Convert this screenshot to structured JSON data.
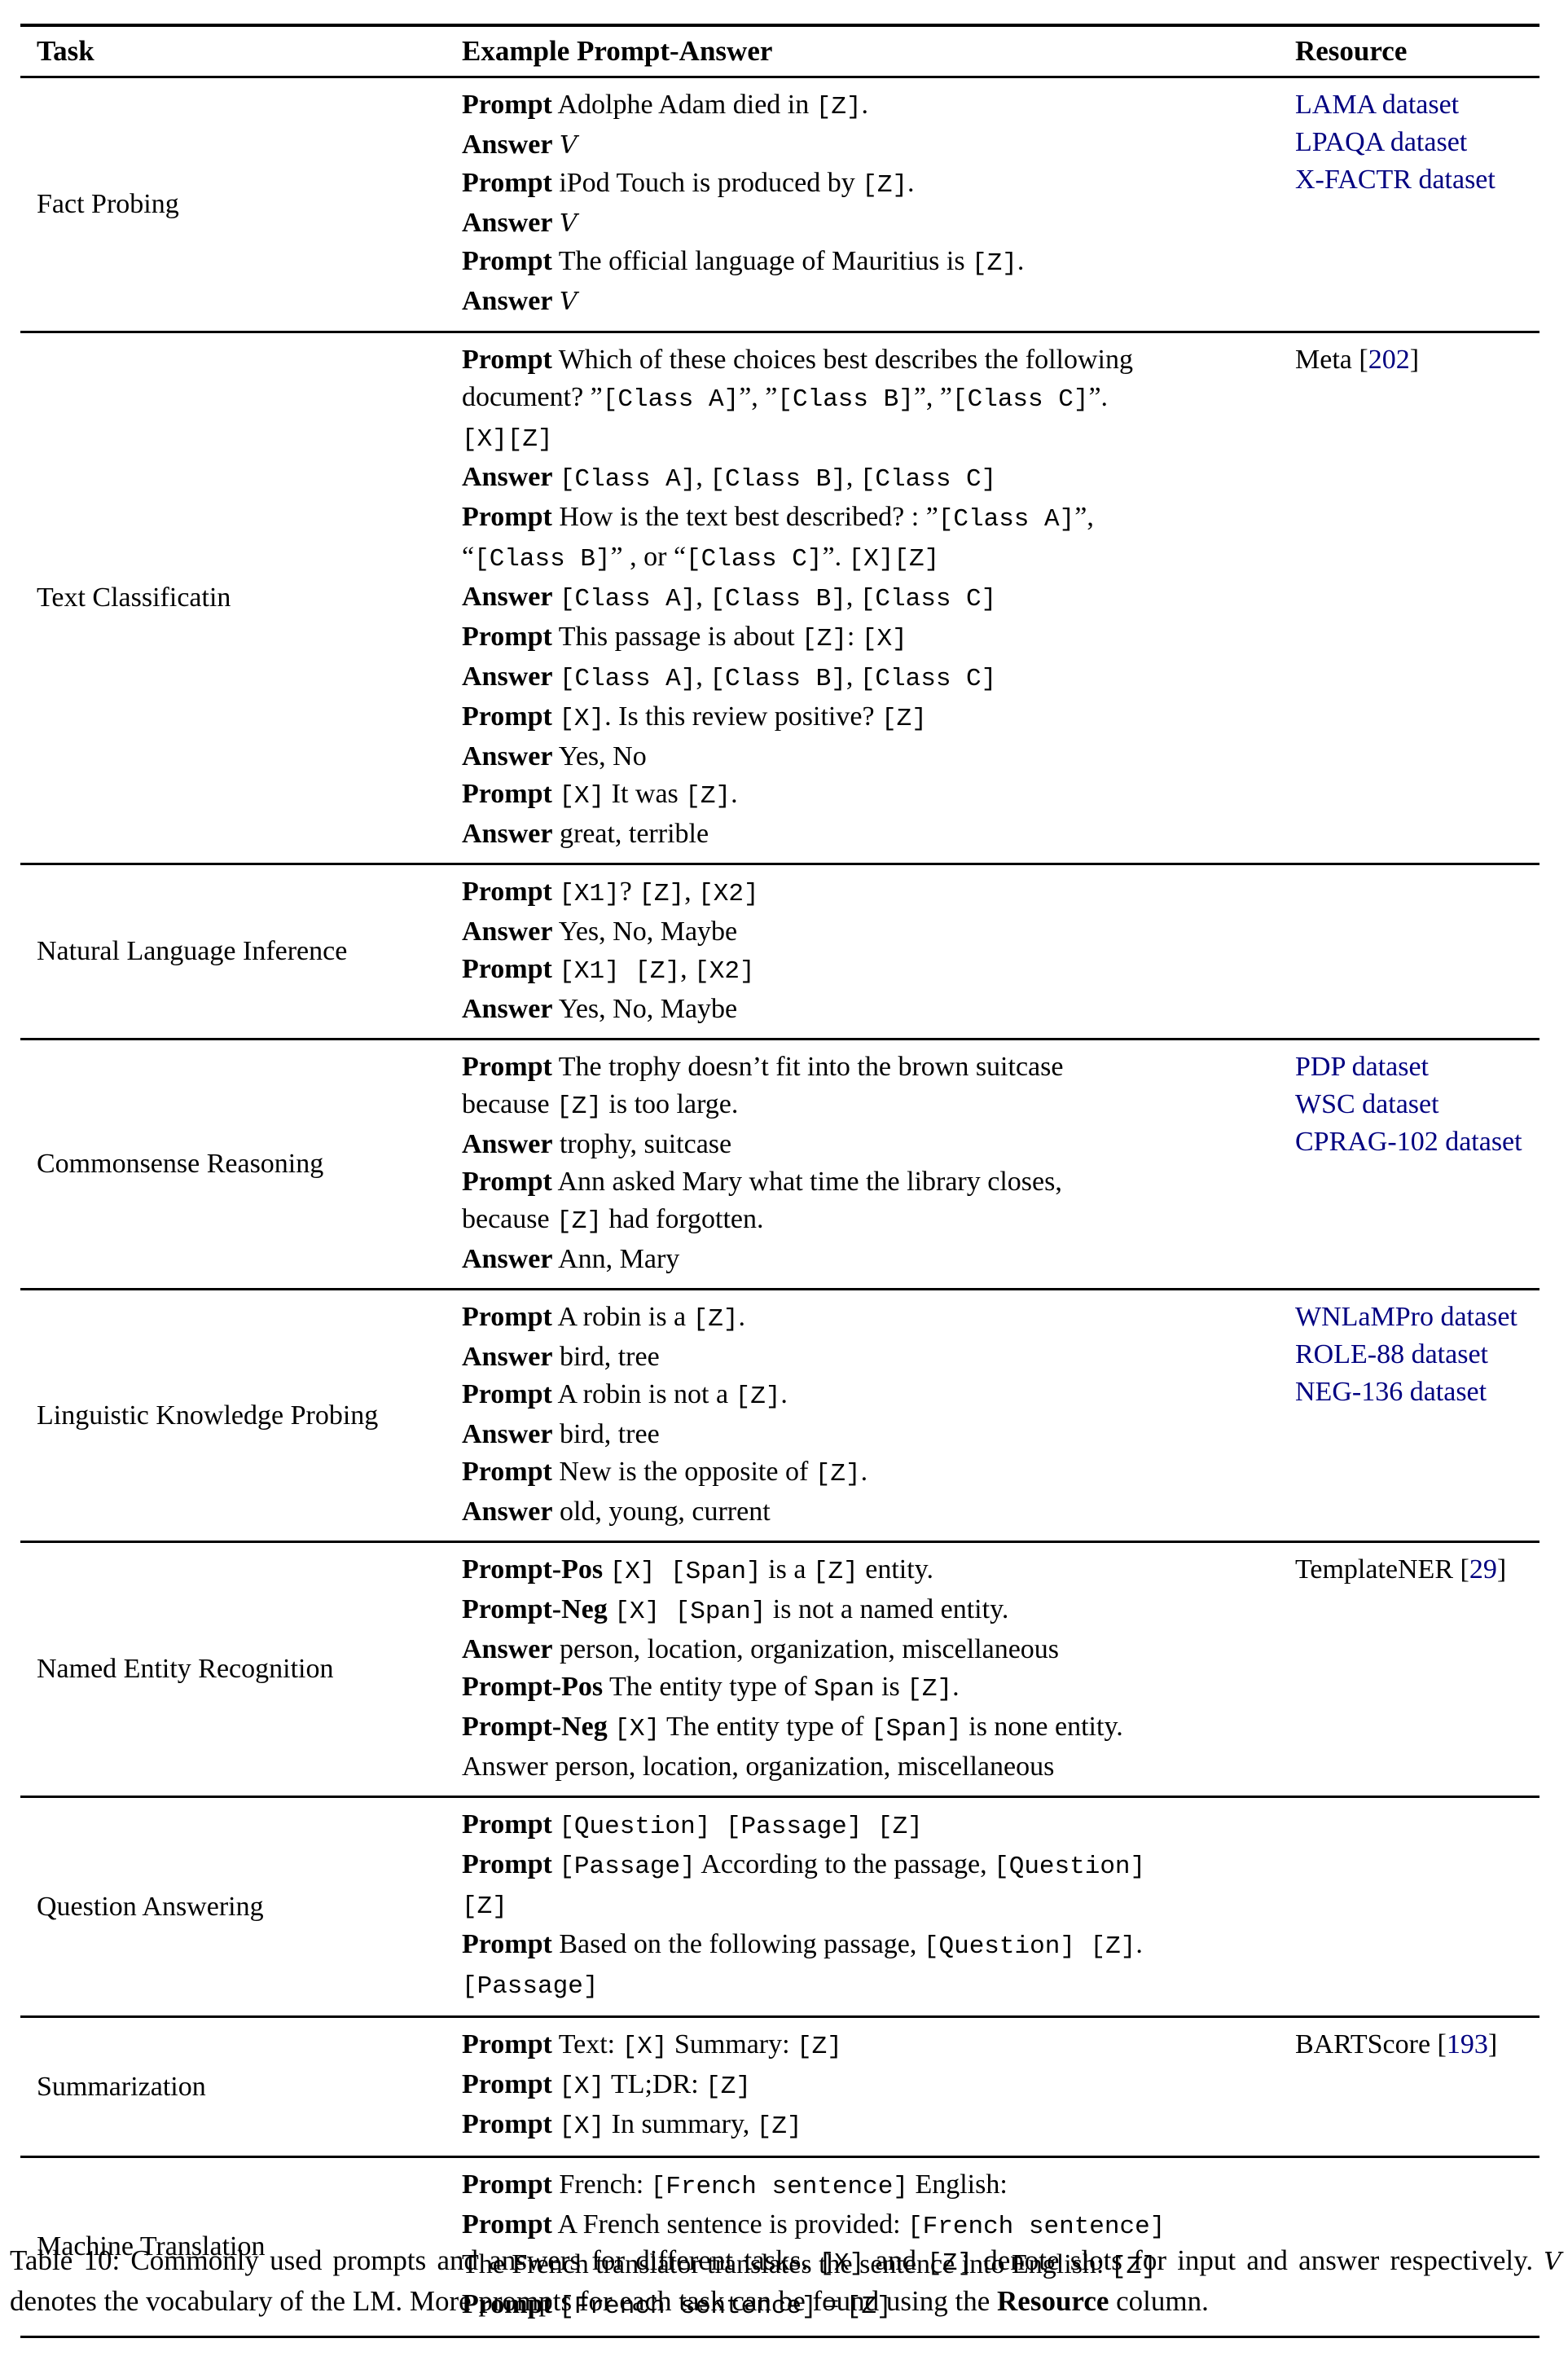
{
  "table": {
    "headers": [
      "Task",
      "Example Prompt-Answer",
      "Resource"
    ],
    "rows": [
      {
        "task": "Fact Probing",
        "lines": [
          {
            "label": "Prompt",
            "segs": [
              {
                "t": "Adolphe Adam died in "
              },
              {
                "m": "[Z]"
              },
              {
                "t": "."
              }
            ]
          },
          {
            "label": "Answer",
            "segs": [
              {
                "v": "V"
              }
            ]
          },
          {
            "label": "Prompt",
            "segs": [
              {
                "t": "iPod Touch is produced by "
              },
              {
                "m": "[Z]"
              },
              {
                "t": "."
              }
            ]
          },
          {
            "label": "Answer",
            "segs": [
              {
                "v": "V"
              }
            ]
          },
          {
            "label": "Prompt",
            "segs": [
              {
                "t": "The official language of Mauritius is "
              },
              {
                "m": "[Z]"
              },
              {
                "t": "."
              }
            ]
          },
          {
            "label": "Answer",
            "segs": [
              {
                "v": "V"
              }
            ]
          }
        ],
        "resources": [
          {
            "segs": [
              {
                "link": "LAMA dataset"
              }
            ]
          },
          {
            "segs": [
              {
                "link": "LPAQA dataset"
              }
            ]
          },
          {
            "segs": [
              {
                "link": "X-FACTR dataset"
              }
            ]
          }
        ]
      },
      {
        "task": "Text Classificatin",
        "lines": [
          {
            "label": "Prompt",
            "segs": [
              {
                "t": "Which of these choices best describes the following"
              }
            ]
          },
          {
            "label": "",
            "segs": [
              {
                "t": "document? ”"
              },
              {
                "m": "[Class A]"
              },
              {
                "t": "”, ”"
              },
              {
                "m": "[Class B]"
              },
              {
                "t": "”, ”"
              },
              {
                "m": "[Class C]"
              },
              {
                "t": "”."
              }
            ]
          },
          {
            "label": "",
            "segs": [
              {
                "m": "[X][Z]"
              }
            ]
          },
          {
            "label": "Answer",
            "segs": [
              {
                "m": "[Class A]"
              },
              {
                "t": ", "
              },
              {
                "m": "[Class B]"
              },
              {
                "t": ", "
              },
              {
                "m": "[Class C]"
              }
            ]
          },
          {
            "label": "Prompt",
            "segs": [
              {
                "t": "How is the text best described? : ”"
              },
              {
                "m": "[Class A]"
              },
              {
                "t": "”,"
              }
            ]
          },
          {
            "label": "",
            "segs": [
              {
                "t": "“"
              },
              {
                "m": "[Class B]"
              },
              {
                "t": "” , or “"
              },
              {
                "m": "[Class C]"
              },
              {
                "t": "”. "
              },
              {
                "m": "[X][Z]"
              }
            ]
          },
          {
            "label": "Answer",
            "segs": [
              {
                "m": "[Class A]"
              },
              {
                "t": ", "
              },
              {
                "m": "[Class B]"
              },
              {
                "t": ", "
              },
              {
                "m": "[Class C]"
              }
            ]
          },
          {
            "label": "Prompt",
            "segs": [
              {
                "t": "This passage is about "
              },
              {
                "m": "[Z]"
              },
              {
                "t": ": "
              },
              {
                "m": "[X]"
              }
            ]
          },
          {
            "label": "Answer",
            "segs": [
              {
                "m": "[Class A]"
              },
              {
                "t": ", "
              },
              {
                "m": "[Class B]"
              },
              {
                "t": ", "
              },
              {
                "m": "[Class C]"
              }
            ]
          },
          {
            "label": "Prompt",
            "segs": [
              {
                "m": "[X]"
              },
              {
                "t": ". Is this review positive? "
              },
              {
                "m": "[Z]"
              }
            ]
          },
          {
            "label": "Answer",
            "segs": [
              {
                "t": "Yes, No"
              }
            ]
          },
          {
            "label": "Prompt",
            "segs": [
              {
                "m": "[X]"
              },
              {
                "t": " It was "
              },
              {
                "m": "[Z]"
              },
              {
                "t": "."
              }
            ]
          },
          {
            "label": "Answer",
            "segs": [
              {
                "t": "great, terrible"
              }
            ]
          }
        ],
        "resources": [
          {
            "segs": [
              {
                "t": "Meta ["
              },
              {
                "link": "202"
              },
              {
                "t": "]"
              }
            ]
          }
        ]
      },
      {
        "task": "Natural Language Inference",
        "lines": [
          {
            "label": "Prompt",
            "segs": [
              {
                "m": "[X1]"
              },
              {
                "t": "? "
              },
              {
                "m": "[Z]"
              },
              {
                "t": ", "
              },
              {
                "m": "[X2]"
              }
            ]
          },
          {
            "label": "Answer",
            "segs": [
              {
                "t": "Yes, No, Maybe"
              }
            ]
          },
          {
            "label": "Prompt",
            "segs": [
              {
                "m": "[X1] [Z]"
              },
              {
                "t": ", "
              },
              {
                "m": "[X2]"
              }
            ]
          },
          {
            "label": "Answer",
            "segs": [
              {
                "t": "Yes, No, Maybe"
              }
            ]
          }
        ],
        "resources": []
      },
      {
        "task": "Commonsense Reasoning",
        "lines": [
          {
            "label": "Prompt",
            "segs": [
              {
                "t": "The trophy doesn’t fit into the brown suitcase"
              }
            ]
          },
          {
            "label": "",
            "segs": [
              {
                "t": "because "
              },
              {
                "m": "[Z]"
              },
              {
                "t": " is too large."
              }
            ]
          },
          {
            "label": "Answer",
            "segs": [
              {
                "t": "trophy, suitcase"
              }
            ]
          },
          {
            "label": "Prompt",
            "segs": [
              {
                "t": "Ann asked Mary what time the library closes,"
              }
            ]
          },
          {
            "label": "",
            "segs": [
              {
                "t": "because "
              },
              {
                "m": "[Z]"
              },
              {
                "t": " had forgotten."
              }
            ]
          },
          {
            "label": "Answer",
            "segs": [
              {
                "t": "Ann, Mary"
              }
            ]
          }
        ],
        "resources": [
          {
            "segs": [
              {
                "link": "PDP dataset"
              }
            ]
          },
          {
            "segs": [
              {
                "link": "WSC dataset"
              }
            ]
          },
          {
            "segs": [
              {
                "link": "CPRAG-102 dataset"
              }
            ]
          }
        ]
      },
      {
        "task": "Linguistic Knowledge Probing",
        "lines": [
          {
            "label": "Prompt",
            "segs": [
              {
                "t": "A robin is a "
              },
              {
                "m": "[Z]"
              },
              {
                "t": "."
              }
            ]
          },
          {
            "label": "Answer",
            "segs": [
              {
                "t": "bird, tree"
              }
            ]
          },
          {
            "label": "Prompt",
            "segs": [
              {
                "t": "A robin is not a "
              },
              {
                "m": "[Z]"
              },
              {
                "t": "."
              }
            ]
          },
          {
            "label": "Answer",
            "segs": [
              {
                "t": "bird, tree"
              }
            ]
          },
          {
            "label": "Prompt",
            "segs": [
              {
                "t": "New is the opposite of "
              },
              {
                "m": "[Z]"
              },
              {
                "t": "."
              }
            ]
          },
          {
            "label": "Answer",
            "segs": [
              {
                "t": "old, young, current"
              }
            ]
          }
        ],
        "resources": [
          {
            "segs": [
              {
                "link": "WNLaMPro dataset"
              }
            ]
          },
          {
            "segs": [
              {
                "link": "ROLE-88 dataset"
              }
            ]
          },
          {
            "segs": [
              {
                "link": "NEG-136 dataset"
              }
            ]
          }
        ]
      },
      {
        "task": "Named Entity Recognition",
        "lines": [
          {
            "label": "Prompt-Pos",
            "segs": [
              {
                "m": "[X] [Span]"
              },
              {
                "t": " is a "
              },
              {
                "m": "[Z]"
              },
              {
                "t": " entity."
              }
            ]
          },
          {
            "label": "Prompt-Neg",
            "segs": [
              {
                "m": "[X] [Span]"
              },
              {
                "t": " is not a named entity."
              }
            ]
          },
          {
            "label": "Answer",
            "segs": [
              {
                "t": "person, location, organization, miscellaneous"
              }
            ]
          },
          {
            "label": "Prompt-Pos",
            "segs": [
              {
                "t": "The entity type of "
              },
              {
                "m": "Span"
              },
              {
                "t": " is "
              },
              {
                "m": "[Z]"
              },
              {
                "t": "."
              }
            ]
          },
          {
            "label": "Prompt-Neg",
            "segs": [
              {
                "m": "[X]"
              },
              {
                "t": " The entity type of "
              },
              {
                "m": "[Span]"
              },
              {
                "t": " is none entity."
              }
            ]
          },
          {
            "label": "",
            "segs": [
              {
                "t": "Answer person, location, organization, miscellaneous"
              }
            ]
          }
        ],
        "resources": [
          {
            "segs": [
              {
                "t": "TemplateNER ["
              },
              {
                "link": "29"
              },
              {
                "t": "]"
              }
            ]
          }
        ]
      },
      {
        "task": "Question Answering",
        "lines": [
          {
            "label": "Prompt",
            "segs": [
              {
                "m": "[Question] [Passage] [Z]"
              }
            ]
          },
          {
            "label": "Prompt",
            "segs": [
              {
                "m": "[Passage]"
              },
              {
                "t": " According to the passage, "
              },
              {
                "m": "[Question]"
              }
            ]
          },
          {
            "label": "",
            "segs": [
              {
                "m": "[Z]"
              }
            ]
          },
          {
            "label": "Prompt",
            "segs": [
              {
                "t": "Based on the following passage, "
              },
              {
                "m": "[Question] [Z]"
              },
              {
                "t": "."
              }
            ]
          },
          {
            "label": "",
            "segs": [
              {
                "m": "[Passage]"
              }
            ]
          }
        ],
        "resources": []
      },
      {
        "task": "Summarization",
        "lines": [
          {
            "label": "Prompt",
            "segs": [
              {
                "t": "Text: "
              },
              {
                "m": "[X]"
              },
              {
                "t": " Summary: "
              },
              {
                "m": "[Z]"
              }
            ]
          },
          {
            "label": "Prompt",
            "segs": [
              {
                "m": "[X]"
              },
              {
                "t": " TL;DR: "
              },
              {
                "m": "[Z]"
              }
            ]
          },
          {
            "label": "Prompt",
            "segs": [
              {
                "m": "[X]"
              },
              {
                "t": " In summary, "
              },
              {
                "m": "[Z]"
              }
            ]
          }
        ],
        "resources": [
          {
            "segs": [
              {
                "t": "BARTScore ["
              },
              {
                "link": "193"
              },
              {
                "t": "]"
              }
            ]
          }
        ]
      },
      {
        "task": "Machine Translation",
        "lines": [
          {
            "label": "Prompt",
            "segs": [
              {
                "t": "French: "
              },
              {
                "m": "[French sentence]"
              },
              {
                "t": " English:"
              }
            ]
          },
          {
            "label": "Prompt",
            "segs": [
              {
                "t": "A French sentence is provided: "
              },
              {
                "m": "[French sentence]"
              }
            ]
          },
          {
            "label": "",
            "segs": [
              {
                "t": "The French translator translates the sentence into English: "
              },
              {
                "m": "[Z]"
              }
            ]
          },
          {
            "label": "Prompt",
            "segs": [
              {
                "m": "[French sentence]"
              },
              {
                "t": " = "
              },
              {
                "m": "[Z]"
              }
            ]
          }
        ],
        "resources": []
      }
    ]
  },
  "caption": {
    "segs": [
      {
        "t": "Table 10:  Commonly used prompts and answers for different tasks. "
      },
      {
        "m": "[X]"
      },
      {
        "t": " and "
      },
      {
        "m": "[Z]"
      },
      {
        "t": " denote slots for input and answer respectively. "
      },
      {
        "v": "V"
      },
      {
        "t": " denotes the vocabulary of the LM. More prompts for each task can be found using the "
      },
      {
        "b": "Resource"
      },
      {
        "t": " column."
      }
    ]
  },
  "colors": {
    "link": "#000080",
    "text": "#000000",
    "rule": "#000000"
  }
}
